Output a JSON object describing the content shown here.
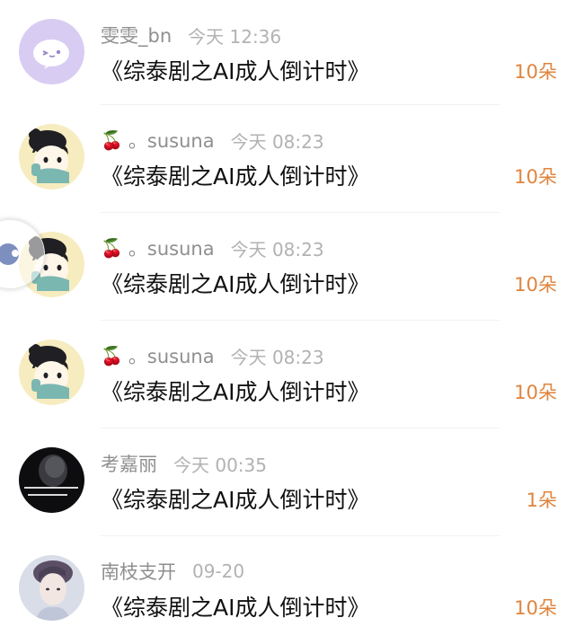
{
  "gifts": [
    {
      "name": "雯雯_bn",
      "prefix": "",
      "time": "今天 12:36",
      "content": "《综泰剧之AI成人倒计时》",
      "count": "10朵",
      "avatar_icon": "sticker-face-icon"
    },
    {
      "name": "。susuna",
      "prefix": "🍒",
      "time": "今天 08:23",
      "content": "《综泰剧之AI成人倒计时》",
      "count": "10朵",
      "avatar_icon": "cartoon-boy-avatar"
    },
    {
      "name": "。susuna",
      "prefix": "🍒",
      "time": "今天 08:23",
      "content": "《综泰剧之AI成人倒计时》",
      "count": "10朵",
      "avatar_icon": "cartoon-boy-avatar"
    },
    {
      "name": "。susuna",
      "prefix": "🍒",
      "time": "今天 08:23",
      "content": "《综泰剧之AI成人倒计时》",
      "count": "10朵",
      "avatar_icon": "cartoon-boy-avatar"
    },
    {
      "name": "考嘉丽",
      "prefix": "",
      "time": "今天 00:35",
      "content": "《综泰剧之AI成人倒计时》",
      "count": "1朵",
      "avatar_icon": "dark-photo-avatar"
    },
    {
      "name": "南枝支开",
      "prefix": "",
      "time": "09-20",
      "content": "《综泰剧之AI成人倒计时》",
      "count": "10朵",
      "avatar_icon": "portrait-photo-avatar"
    }
  ],
  "colors": {
    "name": "#8f8f8f",
    "time": "#b2b2b2",
    "content": "#111111",
    "count": "#e0843d"
  }
}
